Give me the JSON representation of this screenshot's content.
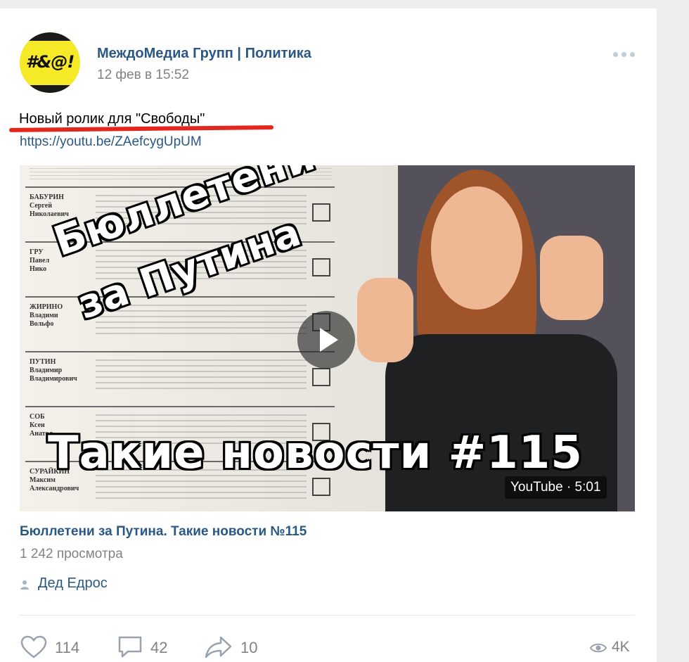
{
  "post": {
    "avatar_text": "#&@!",
    "author": "МеждоМедиа Групп | Политика",
    "date": "12 фев в 15:52",
    "text": "Новый ролик для \"Свободы\"",
    "link": "https://youtu.be/ZAefcygUpUM"
  },
  "video": {
    "thumb_title_line1": "Бюллетени",
    "thumb_title_line2": "за Путина",
    "thumb_title_line3": "Такие новости #115",
    "duration_badge": "YouTube · 5:01",
    "title": "Бюллетени за Путина. Такие новости №115",
    "views": "1 242 просмотра"
  },
  "ballot": {
    "candidates": [
      "БАБУРИН\nСергей\nНиколаевич",
      "ГРУ\nПавел\nНико",
      "ЖИРИНО\nВладими\nВольфо",
      "ПУТИН\nВладимир\nВладимирович",
      "СОБ\nКсен\nАнатол",
      "СУРАЙКИН\nМаксим\nАлександрович"
    ]
  },
  "signer": {
    "name": "Дед Едрос"
  },
  "actions": {
    "likes": "114",
    "comments": "42",
    "shares": "10",
    "views": "4K"
  },
  "colors": {
    "link": "#2a5885",
    "muted": "#828282",
    "underline": "#e3261e",
    "avatar_bg": "#f6e928"
  }
}
